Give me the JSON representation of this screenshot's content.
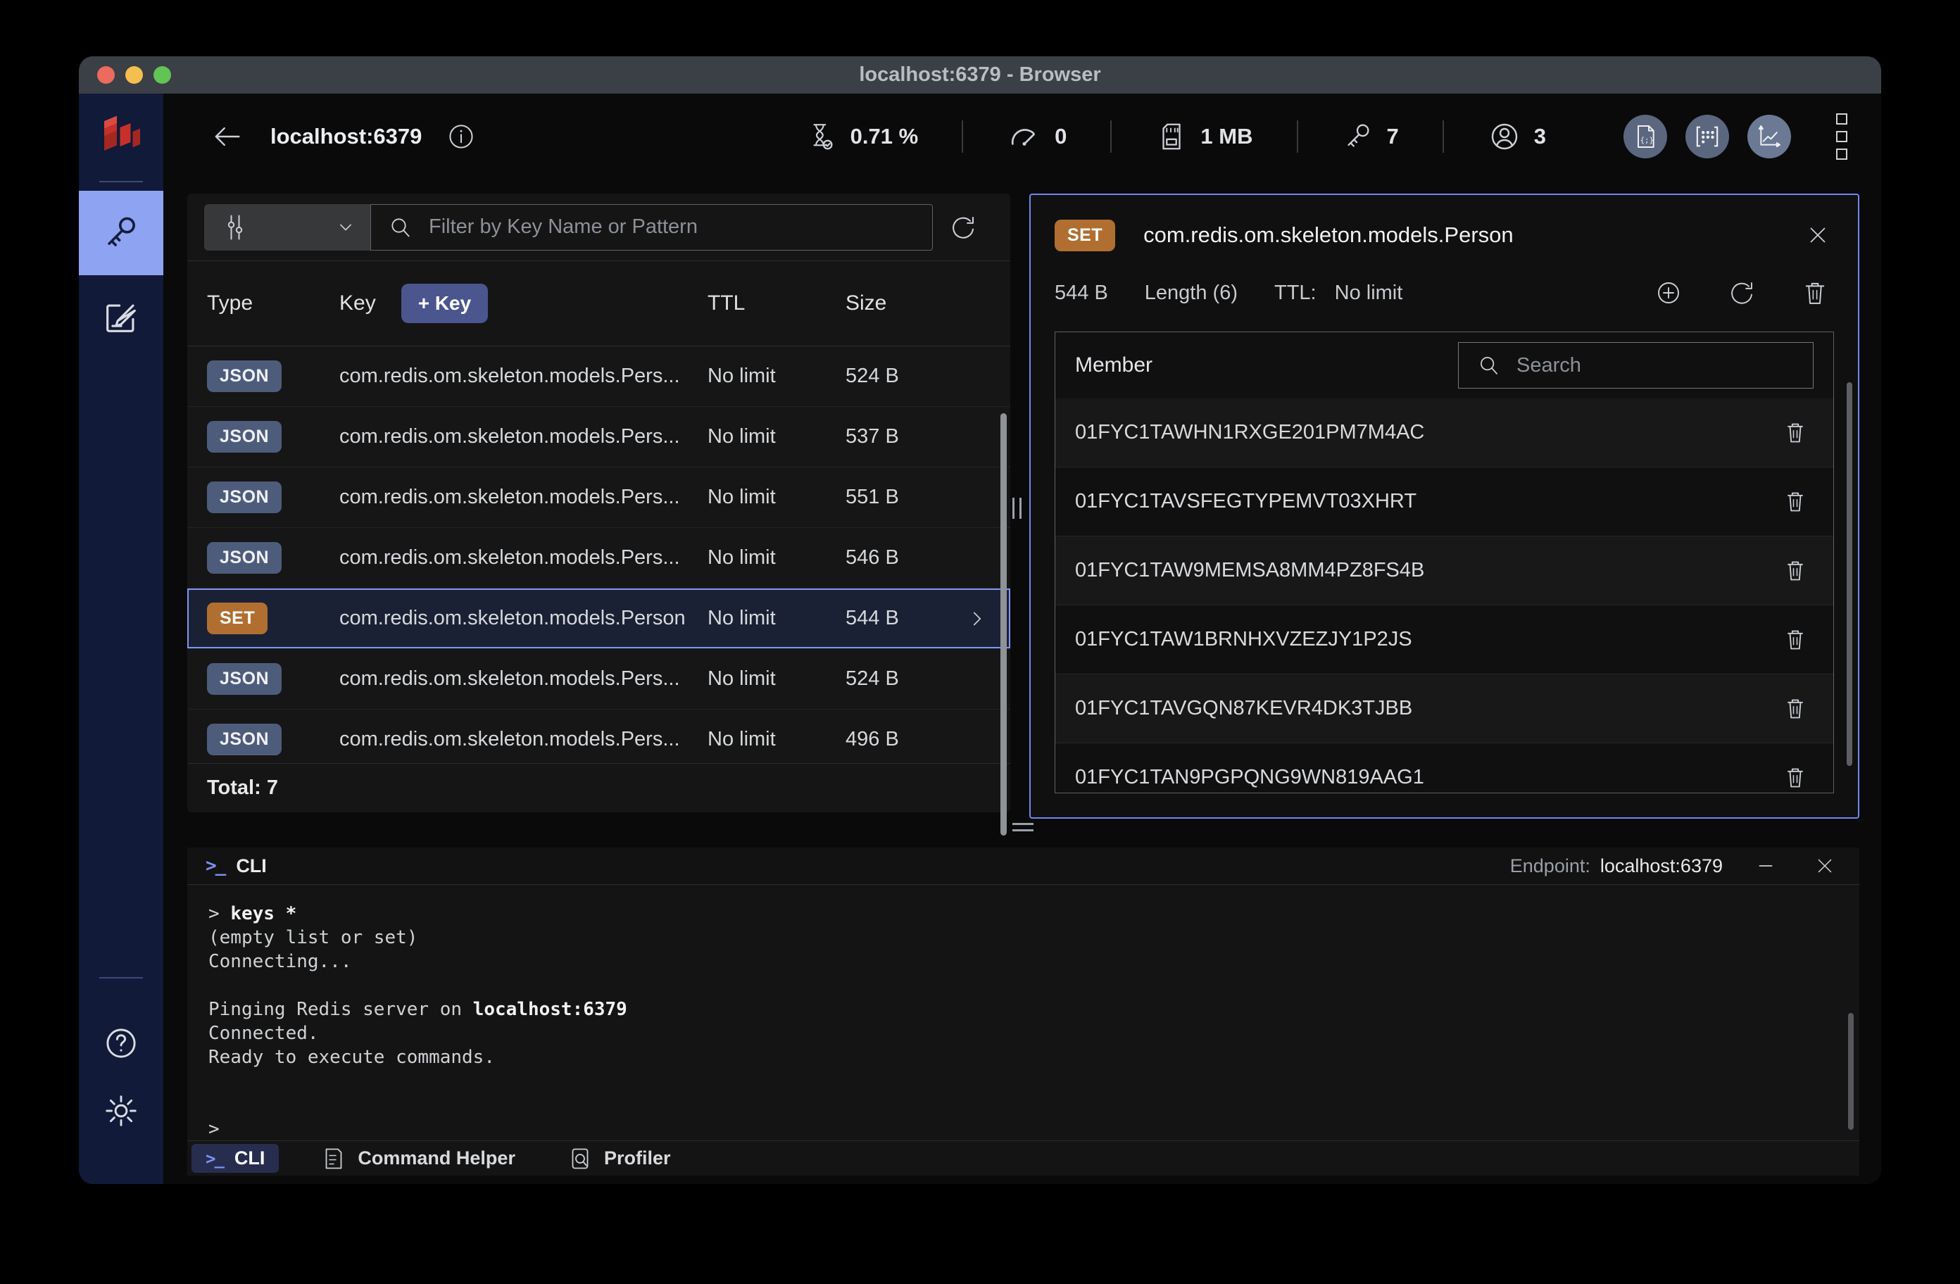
{
  "window": {
    "title": "localhost:6379 - Browser"
  },
  "sidebar": {
    "items": [
      {
        "name": "browser",
        "icon": "key-icon",
        "active": true
      },
      {
        "name": "workbench",
        "icon": "edit-square-icon",
        "active": false
      }
    ],
    "bottom": [
      {
        "name": "help",
        "icon": "help-circle-icon"
      },
      {
        "name": "settings",
        "icon": "gear-icon"
      }
    ]
  },
  "header": {
    "db_name": "localhost:6379",
    "stats": [
      {
        "id": "cpu",
        "icon": "hourglass-icon",
        "value": "0.71 %"
      },
      {
        "id": "commands-per-sec",
        "icon": "gauge-icon",
        "value": "0"
      },
      {
        "id": "memory",
        "icon": "memory-card-icon",
        "value": "1 MB"
      },
      {
        "id": "total-keys",
        "icon": "key-icon",
        "value": "7"
      },
      {
        "id": "connected-clients",
        "icon": "user-icon",
        "value": "3"
      }
    ],
    "actions": [
      "workbench-file-button",
      "grid-button",
      "analysis-chart-button",
      "overflow-menu"
    ]
  },
  "keys_panel": {
    "filter_placeholder": "Filter by Key Name or Pattern",
    "columns": {
      "type": "Type",
      "key": "Key",
      "add_key": "+ Key",
      "ttl": "TTL",
      "size": "Size"
    },
    "rows": [
      {
        "type": "JSON",
        "name": "com.redis.om.skeleton.models.Pers...",
        "ttl": "No limit",
        "size": "524 B",
        "selected": false
      },
      {
        "type": "JSON",
        "name": "com.redis.om.skeleton.models.Pers...",
        "ttl": "No limit",
        "size": "537 B",
        "selected": false
      },
      {
        "type": "JSON",
        "name": "com.redis.om.skeleton.models.Pers...",
        "ttl": "No limit",
        "size": "551 B",
        "selected": false
      },
      {
        "type": "JSON",
        "name": "com.redis.om.skeleton.models.Pers...",
        "ttl": "No limit",
        "size": "546 B",
        "selected": false
      },
      {
        "type": "SET",
        "name": "com.redis.om.skeleton.models.Person",
        "ttl": "No limit",
        "size": "544 B",
        "selected": true
      },
      {
        "type": "JSON",
        "name": "com.redis.om.skeleton.models.Pers...",
        "ttl": "No limit",
        "size": "524 B",
        "selected": false
      },
      {
        "type": "JSON",
        "name": "com.redis.om.skeleton.models.Pers...",
        "ttl": "No limit",
        "size": "496 B",
        "selected": false
      }
    ],
    "total": "Total: 7"
  },
  "details_panel": {
    "type_badge": "SET",
    "key_name": "com.redis.om.skeleton.models.Person",
    "size": "544 B",
    "length": "Length (6)",
    "ttl_label": "TTL:",
    "ttl_value": "No limit",
    "member_column": "Member",
    "search_placeholder": "Search",
    "members": [
      "01FYC1TAWHN1RXGE201PM7M4AC",
      "01FYC1TAVSFEGTYPEMVT03XHRT",
      "01FYC1TAW9MEMSA8MM4PZ8FS4B",
      "01FYC1TAW1BRNHXVZEZJY1P2JS",
      "01FYC1TAVGQN87KEVR4DK3TJBB",
      "01FYC1TAN9PGPQNG9WN819AAG1"
    ]
  },
  "cli": {
    "title": "CLI",
    "endpoint_label": "Endpoint:",
    "endpoint_value": "localhost:6379",
    "lines": [
      {
        "pre": "> ",
        "strong": "keys *"
      },
      {
        "pre": "(empty list or set)"
      },
      {
        "pre": "Connecting..."
      },
      {},
      {
        "pre": "Pinging Redis server on ",
        "strong": "localhost:6379"
      },
      {
        "pre": "Connected."
      },
      {
        "pre": "Ready to execute commands."
      },
      {},
      {},
      {
        "pre": ">"
      }
    ],
    "tabs": [
      {
        "label": "CLI",
        "active": true
      },
      {
        "label": "Command Helper",
        "active": false
      },
      {
        "label": "Profiler",
        "active": false
      }
    ]
  },
  "colors": {
    "accent_border": "#6f88ee",
    "sidebar_active": "#8ea3f1",
    "badge_json": "#4e5c7c",
    "badge_set": "#b06f30",
    "redis_red": "#c6302b",
    "cli_prompt_blue": "#7d92f2"
  }
}
